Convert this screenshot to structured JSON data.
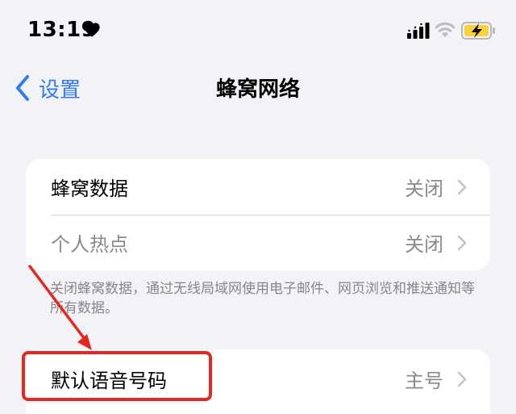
{
  "status_bar": {
    "time": "13:19",
    "heart_icon": "heart-icon",
    "signal_icon": "cellular-signal-icon",
    "wifi_icon": "wifi-icon",
    "battery_icon": "battery-charging-icon"
  },
  "nav": {
    "back_label": "设置",
    "title": "蜂窝网络"
  },
  "section_cellular": {
    "rows": [
      {
        "label": "蜂窝数据",
        "value": "关闭"
      },
      {
        "label": "个人热点",
        "value": "关闭"
      }
    ],
    "footer": "关闭蜂窝数据，通过无线局域网使用电子邮件、网页浏览和推送通知等所有数据。"
  },
  "section_voice": {
    "rows": [
      {
        "label": "默认语音号码",
        "value": "主号"
      }
    ]
  },
  "colors": {
    "accent_blue": "#2f7bf6",
    "annotation_red": "#e5281e",
    "battery_yellow": "#f7d23a",
    "background": "#f2f2f7"
  }
}
